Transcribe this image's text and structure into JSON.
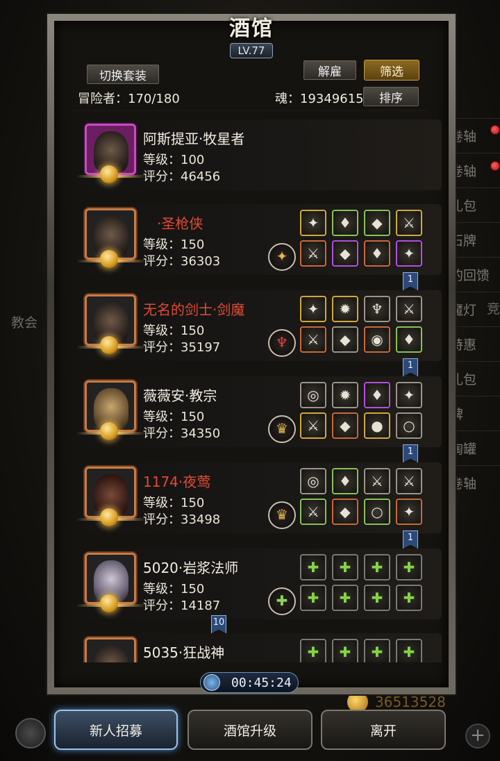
{
  "window": {
    "title": "酒馆",
    "level": "LV.77"
  },
  "toolbar": {
    "switch_outfit_label": "切换套装",
    "dismiss_label": "解雇",
    "filter_label": "筛选",
    "sort_label": "排序"
  },
  "stats": {
    "adventurers": "冒险者：170/180",
    "soul": "魂：19349615"
  },
  "heroes": [
    {
      "name": "阿斯提亚·牧星者",
      "name_color": "white",
      "level": "等级：100",
      "score": "评分：46456",
      "frame": "purple"
    },
    {
      "name": "·圣枪侠",
      "name_color": "red",
      "level": "等级：150",
      "score": "评分：36303",
      "frame": "orange",
      "class_icon": "gold-wings-icon",
      "tag": "1"
    },
    {
      "name": "无名的剑士·剑魔",
      "name_color": "red",
      "level": "等级：150",
      "score": "评分：35197",
      "frame": "orange",
      "class_icon": "red-horns-icon",
      "tag": "1"
    },
    {
      "name": "薇薇安·教宗",
      "name_color": "white",
      "level": "等级：150",
      "score": "评分：34350",
      "frame": "orange",
      "class_icon": "gold-crown-icon",
      "tag": "1"
    },
    {
      "name": "1174·夜莺",
      "name_color": "red",
      "level": "等级：150",
      "score": "评分：33498",
      "frame": "orange",
      "class_icon": "gold-crown-icon",
      "tag": "1"
    },
    {
      "name": "5020·岩浆法师",
      "name_color": "white",
      "level": "等级：150",
      "score": "评分：14187",
      "frame": "orange",
      "class_icon": "green-plus-icon",
      "tag": "10"
    },
    {
      "name": "5035·狂战神",
      "name_color": "white",
      "level": "",
      "score": "",
      "frame": "orange"
    }
  ],
  "equipment_icons": [
    "✦",
    "◆",
    "♦",
    "⚔",
    "✚"
  ],
  "timer": "00:45:24",
  "background": {
    "menu": [
      "卷轴",
      "卷轴",
      "礼包",
      "石牌",
      "的回馈",
      "魔灯",
      "特惠",
      "礼包",
      "碑",
      "陶罐",
      "卷轴"
    ],
    "left_text": "教会",
    "right_text": "竞",
    "coins": "36513528"
  },
  "actions": {
    "recruit_label": "新人招募",
    "upgrade_label": "酒馆升级",
    "leave_label": "离开"
  },
  "colors": {
    "accent_gold": "#d0a93b",
    "name_red": "#e04a36",
    "frame": "#5a554d"
  }
}
